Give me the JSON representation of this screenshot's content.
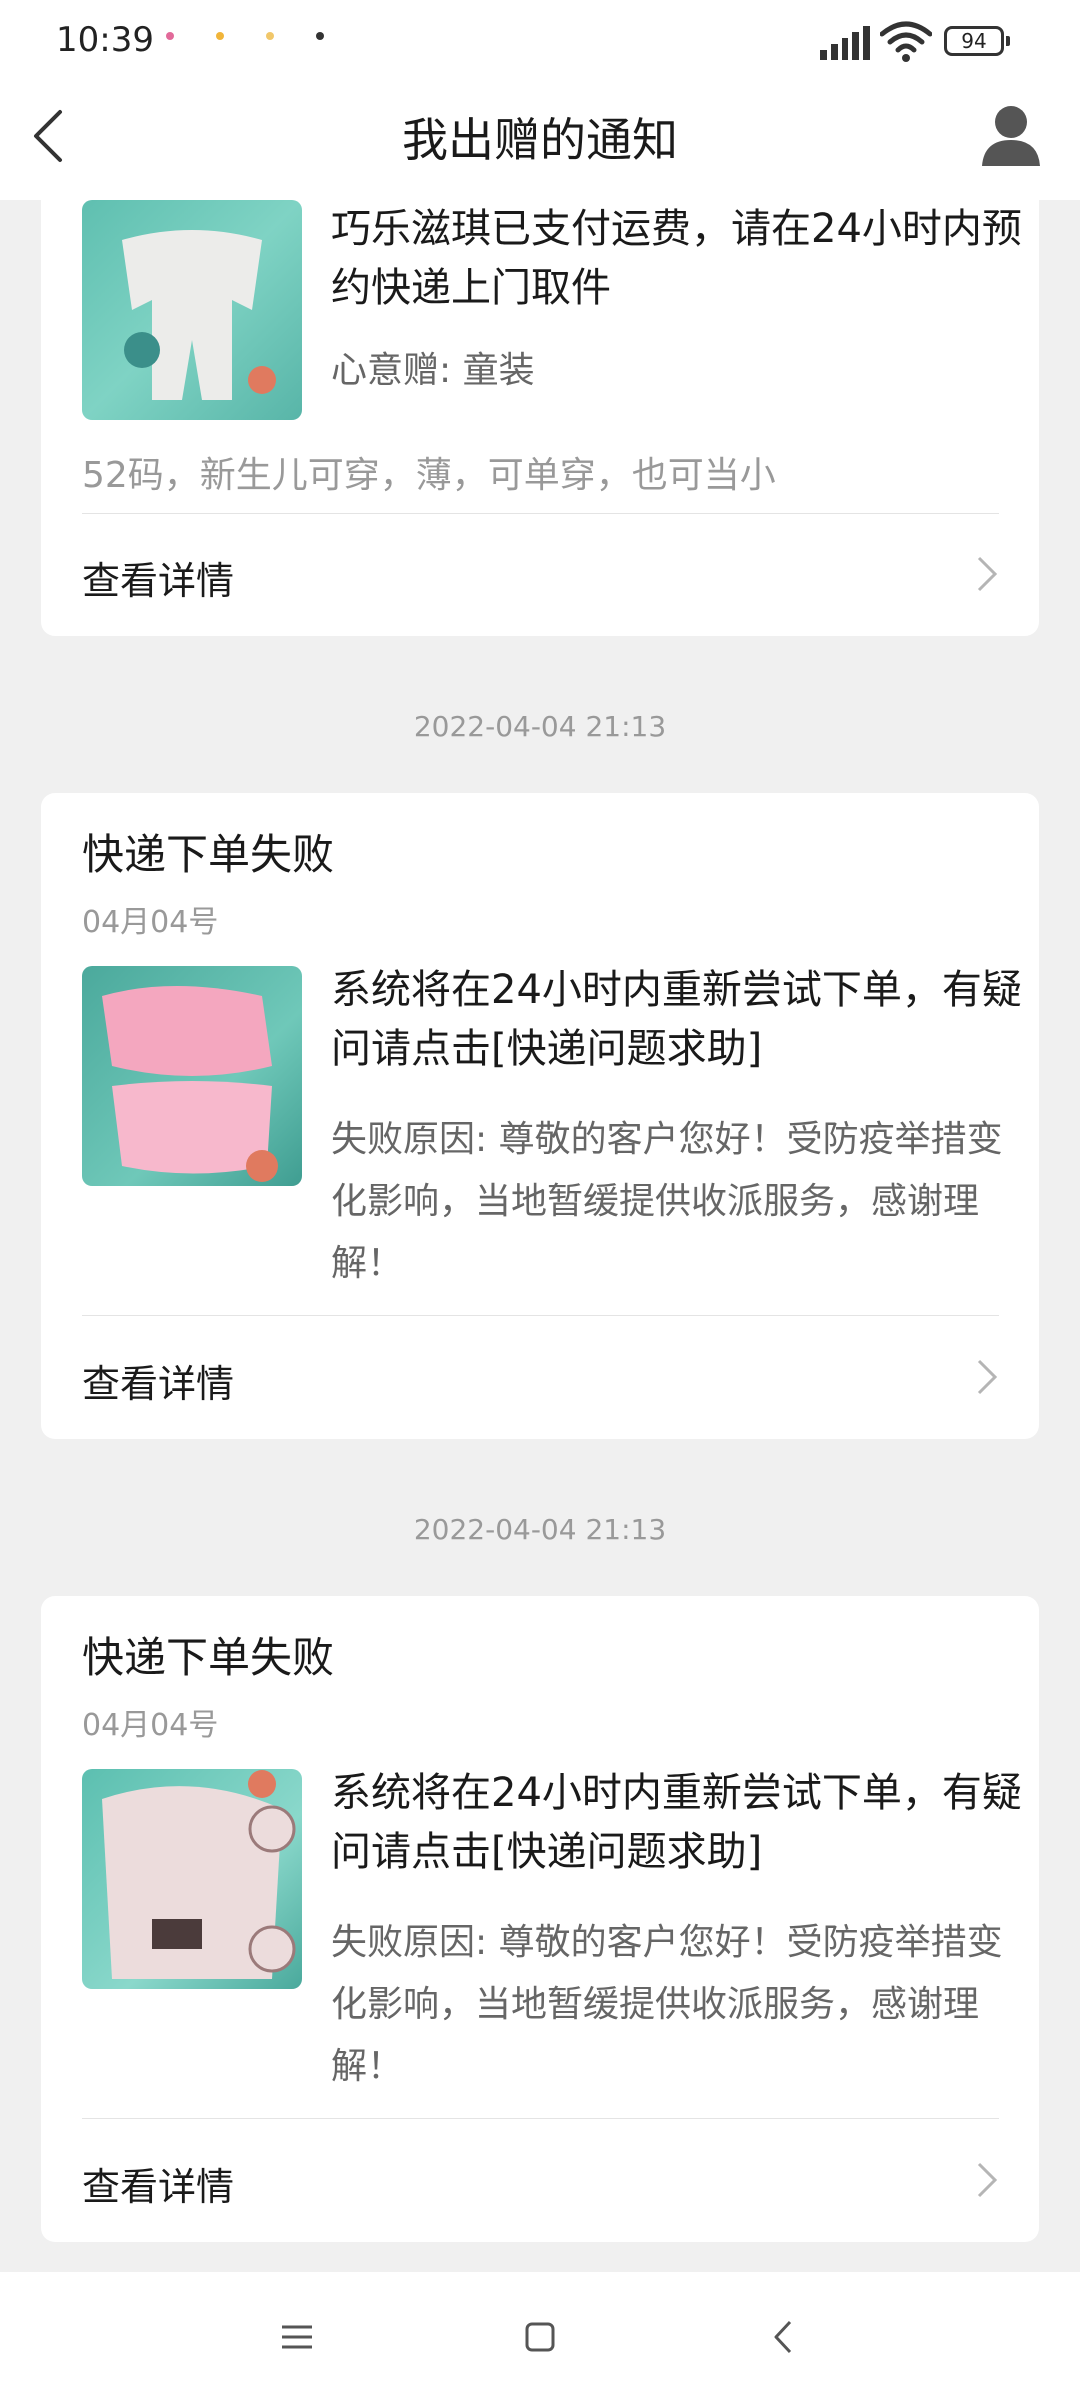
{
  "status_bar": {
    "time": "10:39",
    "battery": "94"
  },
  "header": {
    "title": "我出赠的通知"
  },
  "cards": [
    {
      "main": "巧乐滋琪已支付运费，请在24小时内预约快递上门取件",
      "sub": "心意赠: 童装",
      "desc": "52码，新生儿可穿，薄，可单穿，也可当小",
      "view": "查看详情"
    },
    {
      "timestamp": "2022-04-04 21:13",
      "title": "快递下单失败",
      "date": "04月04号",
      "main": "系统将在24小时内重新尝试下单，有疑问请点击[快递问题求助]",
      "sub": "失败原因: 尊敬的客户您好！受防疫举措变化影响，当地暂缓提供收派服务，感谢理解！",
      "view": "查看详情"
    },
    {
      "timestamp": "2022-04-04 21:13",
      "title": "快递下单失败",
      "date": "04月04号",
      "main": "系统将在24小时内重新尝试下单，有疑问请点击[快递问题求助]",
      "sub": "失败原因: 尊敬的客户您好！受防疫举措变化影响，当地暂缓提供收派服务，感谢理解！",
      "view": "查看详情"
    }
  ],
  "icons": {
    "back": "chevron-left-icon",
    "avatar": "user-icon",
    "chevron": "chevron-right-icon",
    "nav_menu": "menu-icon",
    "nav_home": "square-icon",
    "nav_back": "back-triangle-icon"
  },
  "colors": {
    "background": "#f0f0f0",
    "card": "#ffffff",
    "muted": "#999999",
    "secondary": "#666666"
  }
}
